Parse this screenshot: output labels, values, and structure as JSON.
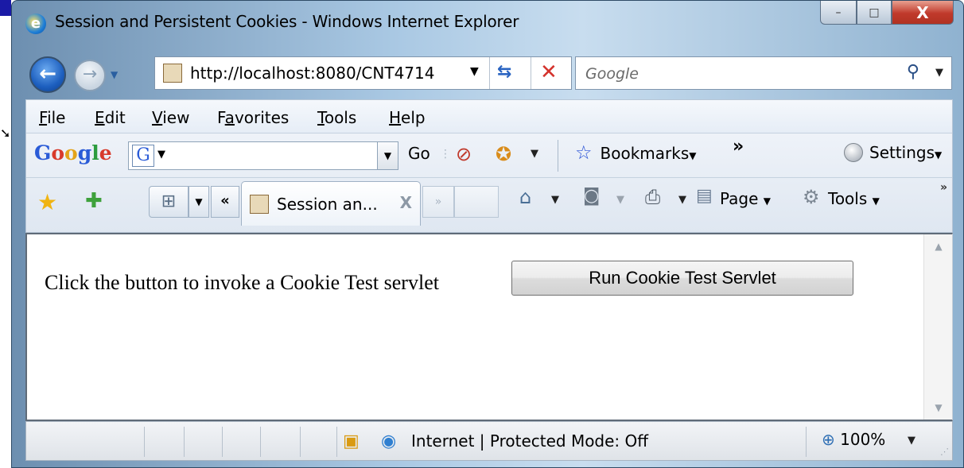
{
  "window": {
    "title": "Session and Persistent Cookies - Windows Internet Explorer",
    "controls": {
      "minimize": "–",
      "maximize": "□",
      "close": "X"
    }
  },
  "nav": {
    "back_icon": "back-arrow",
    "forward_icon": "forward-arrow",
    "address": "http://localhost:8080/CNT4714",
    "search_placeholder": "Google"
  },
  "menu": {
    "items": [
      {
        "label": "File",
        "key": "F",
        "rest": "ile"
      },
      {
        "label": "Edit",
        "key": "E",
        "rest": "dit"
      },
      {
        "label": "View",
        "key": "V",
        "rest": "iew"
      },
      {
        "label": "Favorites",
        "pre": "F",
        "key": "a",
        "rest": "vorites"
      },
      {
        "label": "Tools",
        "key": "T",
        "rest": "ools"
      },
      {
        "label": "Help",
        "key": "H",
        "rest": "elp"
      }
    ]
  },
  "google_toolbar": {
    "logo": [
      "G",
      "o",
      "o",
      "g",
      "l",
      "e"
    ],
    "g_icon": "G",
    "go_label": "Go",
    "bookmarks_label": "Bookmarks",
    "more": "»",
    "settings_label": "Settings"
  },
  "tabs": {
    "active_title": "Session an...",
    "close": "X",
    "scroll_left": "«",
    "scroll_right": "»",
    "more": "»"
  },
  "commands": {
    "page_label": "Page",
    "tools_label": "Tools"
  },
  "content": {
    "text": "Click the button to invoke a Cookie Test servlet",
    "button_label": "Run Cookie Test Servlet"
  },
  "status": {
    "zone": "Internet | Protected Mode: Off",
    "zoom": "100%"
  },
  "colors": {
    "accent": "#1d5fbf",
    "close_button": "#c0392b",
    "stop": "#d4322c"
  }
}
